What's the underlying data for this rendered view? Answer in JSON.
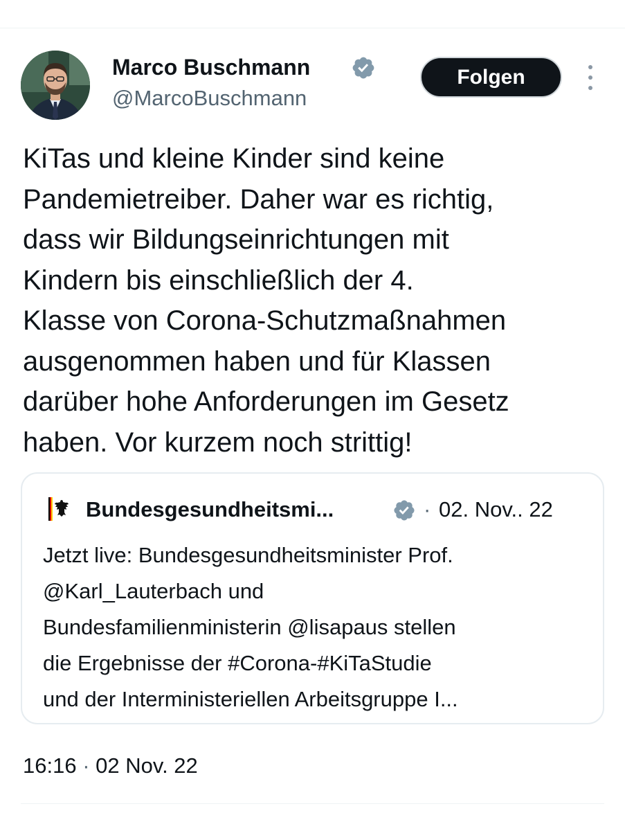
{
  "author": {
    "name": "Marco Buschmann",
    "handle": "@MarcoBuschmann",
    "verified_icon": "verified-badge-icon",
    "avatar_icon": "profile-photo"
  },
  "actions": {
    "follow_label": "Folgen",
    "more_icon": "more-vertical-icon"
  },
  "tweet": {
    "lines": [
      "KiTas und kleine Kinder sind keine",
      "Pandemietreiber. Daher war es richtig,",
      "dass wir Bildungseinrichtungen mit",
      "Kindern bis einschließlich der 4.",
      "Klasse von Corona-Schutzmaßnahmen",
      "ausgenommen haben und für Klassen",
      "darüber hohe Anforderungen im Gesetz",
      "haben. Vor kurzem noch strittig!"
    ],
    "time": "16:16",
    "separator": "·",
    "date": "02 Nov. 22"
  },
  "quoted": {
    "name": "Bundesgesundheitsmi...",
    "avatar_icon": "federal-eagle-icon",
    "verified_icon": "verified-badge-icon",
    "separator": "·",
    "date": "02. Nov.. 22",
    "lines": [
      "Jetzt live: Bundesgesundheitsminister Prof.",
      "@Karl_Lauterbach und",
      "Bundesfamilienministerin @lisapaus stellen",
      "die Ergebnisse der #Corona-#KiTaStudie",
      "und der Interministeriellen Arbeitsgruppe I..."
    ]
  },
  "colors": {
    "text": "#0f1419",
    "secondary": "#536471",
    "verified_gray": "#829aab",
    "button_bg": "#0f1419",
    "border": "#e6ecf0"
  }
}
